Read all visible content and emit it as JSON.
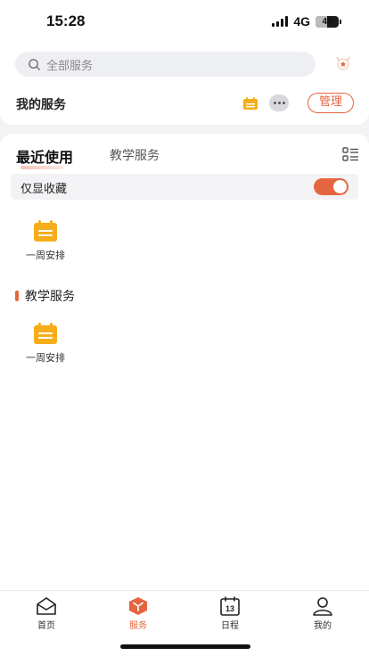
{
  "status_bar": {
    "time": "15:28",
    "network": "4G",
    "battery": "49",
    "battery_level": 0.49
  },
  "header": {
    "search_placeholder": "全部服务",
    "my_services_label": "我的服务",
    "manage_label": "管理"
  },
  "tabs": [
    {
      "label": "最近使用",
      "active": true
    },
    {
      "label": "教学服务",
      "active": false
    }
  ],
  "favorites_only": {
    "label": "仅显收藏",
    "enabled": true
  },
  "recent_services": [
    {
      "label": "一周安排",
      "icon": "calendar-icon"
    }
  ],
  "section": {
    "title": "教学服务",
    "items": [
      {
        "label": "一周安排",
        "icon": "calendar-icon"
      }
    ]
  },
  "bottom_nav": [
    {
      "label": "首页",
      "icon": "home-mail-icon",
      "active": false
    },
    {
      "label": "服务",
      "icon": "service-box-icon",
      "active": true
    },
    {
      "label": "日程",
      "icon": "calendar-13-icon",
      "day": "13",
      "active": false
    },
    {
      "label": "我的",
      "icon": "user-icon",
      "active": false
    }
  ],
  "colors": {
    "accent": "#e4653f",
    "icon_yellow": "#f6ad1b"
  }
}
